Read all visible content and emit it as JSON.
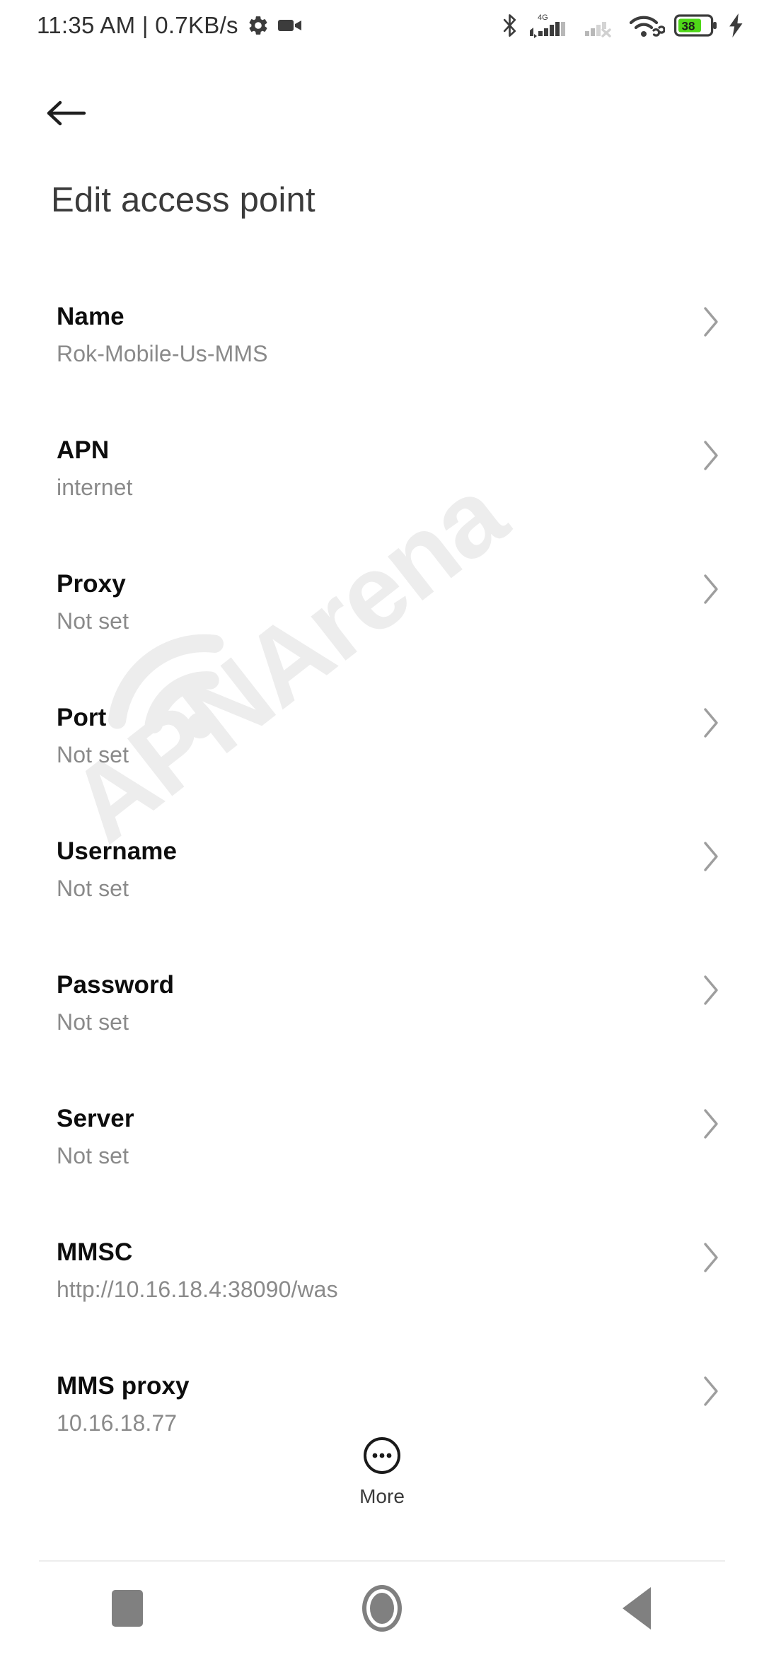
{
  "status_bar": {
    "clock": "11:35 AM | 0.7KB/s",
    "icons_left": [
      "gear-icon",
      "video-camera-icon"
    ],
    "icons_right": [
      "bluetooth-icon",
      "signal-4g-icon",
      "signal-sim2-off-icon",
      "wifi-link-icon",
      "battery-icon",
      "charging-bolt-icon"
    ],
    "network_label": "4G",
    "battery_percent": "38",
    "battery_fill_color": "#4FD818"
  },
  "header": {
    "back_icon": "back-arrow-icon",
    "title": "Edit access point"
  },
  "settings": {
    "rows": [
      {
        "label": "Name",
        "value": "Rok-Mobile-Us-MMS"
      },
      {
        "label": "APN",
        "value": "internet"
      },
      {
        "label": "Proxy",
        "value": "Not set"
      },
      {
        "label": "Port",
        "value": "Not set"
      },
      {
        "label": "Username",
        "value": "Not set"
      },
      {
        "label": "Password",
        "value": "Not set"
      },
      {
        "label": "Server",
        "value": "Not set"
      },
      {
        "label": "MMSC",
        "value": "http://10.16.18.4:38090/was"
      },
      {
        "label": "MMS proxy",
        "value": "10.16.18.77"
      }
    ],
    "chevron_icon": "chevron-right-icon"
  },
  "more": {
    "label": "More",
    "icon": "more-dots-icon"
  },
  "watermark": {
    "text": "APNArena",
    "icon": "wifi-signal-icon",
    "color": "#ededed"
  },
  "nav_bar": {
    "recents_label": "recents-button",
    "home_label": "home-button",
    "back_label": "back-button"
  }
}
